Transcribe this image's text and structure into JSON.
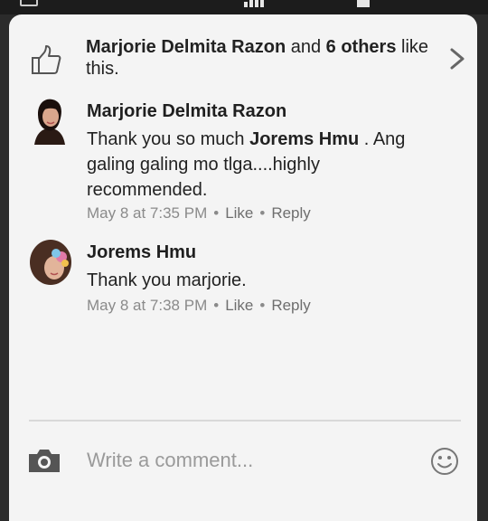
{
  "likes": {
    "first_liker": "Marjorie Delmita Razon",
    "connector": " and ",
    "others": "6 others",
    "suffix": " like this."
  },
  "comments": [
    {
      "author": "Marjorie Delmita Razon",
      "text_before": "Thank you so much ",
      "mention": "Jorems Hmu",
      "text_after": " . Ang galing galing mo tlga....highly recommended.",
      "time": "May 8 at 7:35 PM",
      "like_label": "Like",
      "reply_label": "Reply"
    },
    {
      "author": "Jorems Hmu",
      "text": "Thank you marjorie.",
      "time": "May 8 at 7:38 PM",
      "like_label": "Like",
      "reply_label": "Reply"
    }
  ],
  "composer": {
    "placeholder": "Write a comment..."
  },
  "colors": {
    "panel_bg": "#f4f4f4",
    "meta_gray": "#8a8a8a",
    "text_dark": "#222222"
  },
  "icons": [
    "thumbs-up-icon",
    "chevron-right-icon",
    "camera-icon",
    "smiley-icon"
  ]
}
